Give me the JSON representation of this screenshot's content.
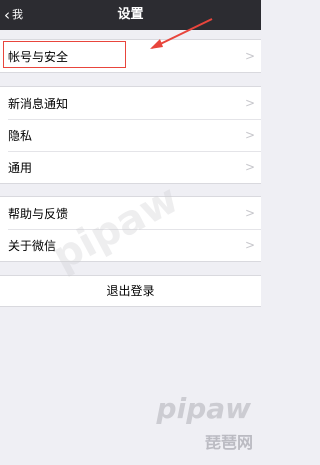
{
  "navbar": {
    "back_label": "我",
    "title": "设置"
  },
  "groups": [
    {
      "items": [
        {
          "label": "帐号与安全"
        }
      ]
    },
    {
      "items": [
        {
          "label": "新消息通知"
        },
        {
          "label": "隐私"
        },
        {
          "label": "通用"
        }
      ]
    },
    {
      "items": [
        {
          "label": "帮助与反馈"
        },
        {
          "label": "关于微信"
        }
      ]
    }
  ],
  "logout_label": "退出登录",
  "watermark": {
    "center": "pipaw",
    "corner_logo": "pipaw",
    "corner_text": "琵琶网"
  },
  "annotation_color": "#e8453c"
}
